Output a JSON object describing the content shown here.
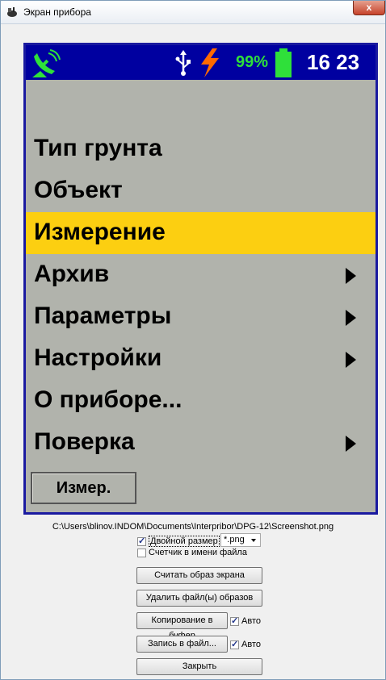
{
  "window": {
    "title": "Экран прибора",
    "close_label": "x"
  },
  "status_bar": {
    "antenna_icon": "satellite-dish-icon",
    "usb_icon": "usb-icon",
    "charging_icon": "lightning-icon",
    "battery_percent": "99%",
    "battery_level": 0.99,
    "time": "16 23",
    "colors": {
      "background": "#0000a0",
      "green": "#2fe03a",
      "orange": "#ff6a00"
    }
  },
  "menu": {
    "items": [
      {
        "label": "Тип грунта",
        "has_submenu": false,
        "selected": false
      },
      {
        "label": "Объект",
        "has_submenu": false,
        "selected": false
      },
      {
        "label": "Измерение",
        "has_submenu": false,
        "selected": true
      },
      {
        "label": "Архив",
        "has_submenu": true,
        "selected": false
      },
      {
        "label": "Параметры",
        "has_submenu": true,
        "selected": false
      },
      {
        "label": "Настройки",
        "has_submenu": true,
        "selected": false
      },
      {
        "label": "О приборе...",
        "has_submenu": false,
        "selected": false
      },
      {
        "label": "Поверка",
        "has_submenu": true,
        "selected": false
      }
    ],
    "selected_color": "#fccf11"
  },
  "soft_button": {
    "label": "Измер."
  },
  "screenshot_path": "C:\\Users\\blinov.INDOM\\Documents\\Interpribor\\DPG-12\\Screenshot.png",
  "options": {
    "double_size": {
      "label": "Двойной размер",
      "checked": true
    },
    "format": {
      "value": "*.png"
    },
    "counter_in_name": {
      "label": "Счетчик в имени файла",
      "checked": false
    }
  },
  "buttons": {
    "read_screen": "Считать образ экрана",
    "delete_files": "Удалить файл(ы) образов",
    "copy_to_buffer": "Копирование в буфер",
    "copy_auto": {
      "label": "Авто",
      "checked": true
    },
    "write_to_file": "Запись в файл...",
    "write_auto": {
      "label": "Авто",
      "checked": true
    },
    "close": "Закрыть"
  }
}
